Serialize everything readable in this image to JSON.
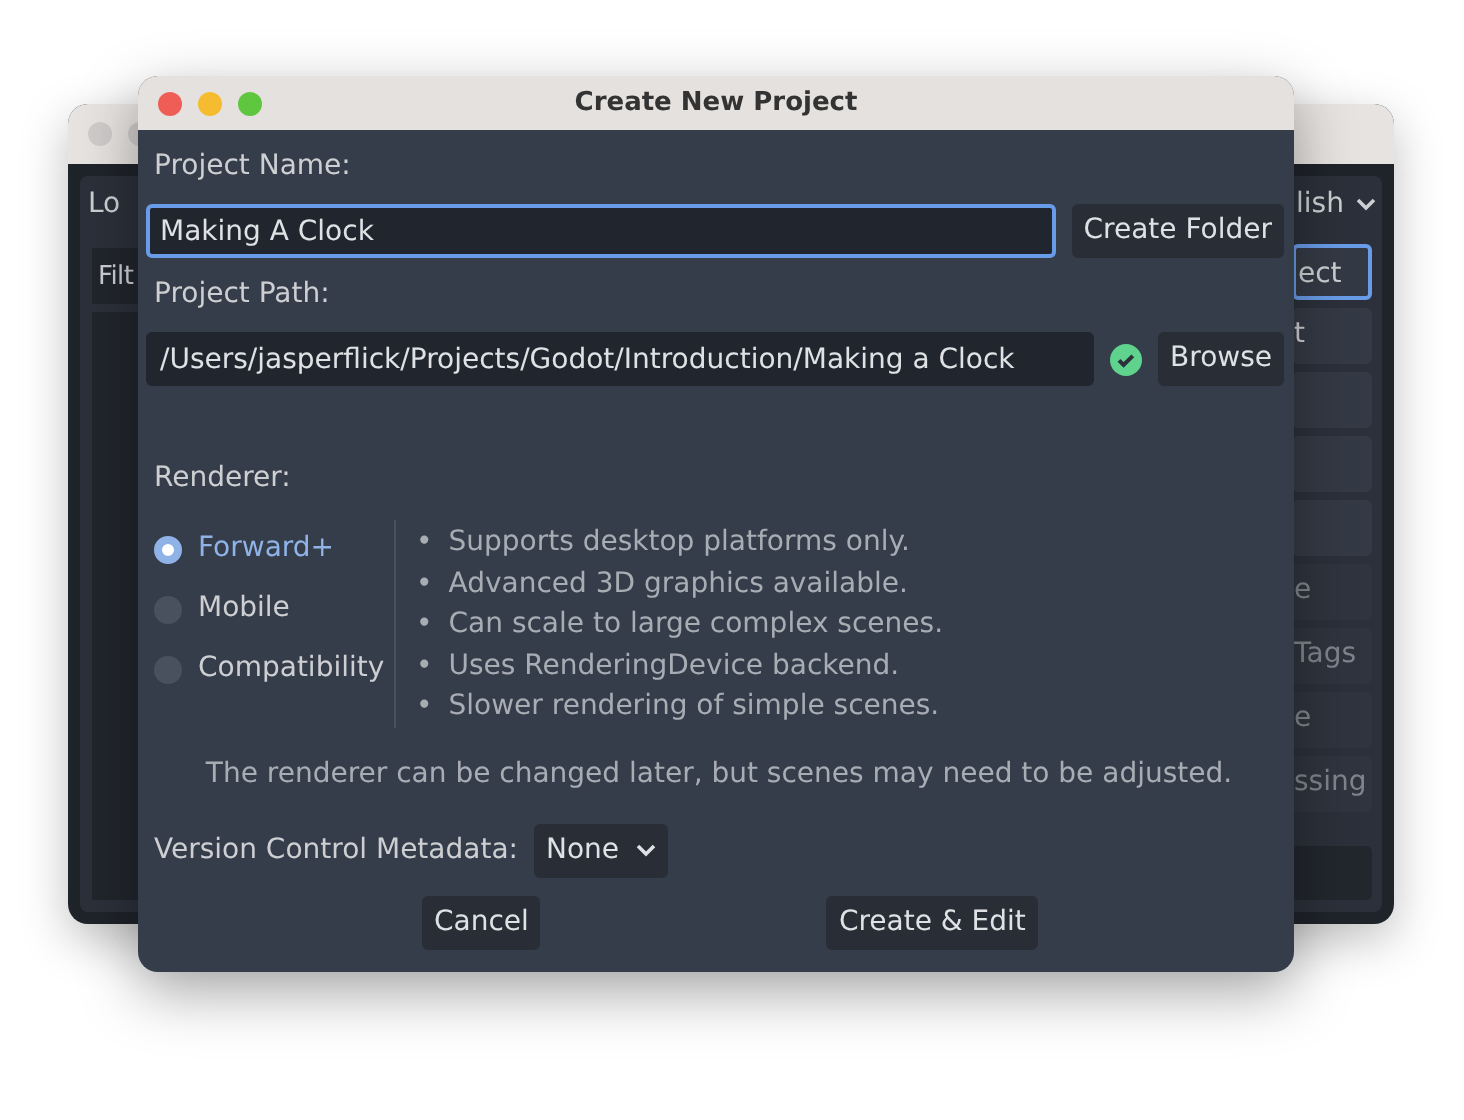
{
  "background_window": {
    "tab": "Lo",
    "filter": "Filt",
    "language": "lish",
    "side_items": [
      {
        "kind": "button",
        "label": "ect",
        "focused": true
      },
      {
        "kind": "button",
        "label": "t",
        "focused": false
      },
      {
        "kind": "blank"
      },
      {
        "kind": "blank"
      },
      {
        "kind": "blank"
      },
      {
        "kind": "dimmed",
        "label": "e"
      },
      {
        "kind": "dimmed",
        "label": "Tags"
      },
      {
        "kind": "dimmed",
        "label": "e"
      },
      {
        "kind": "dimmed",
        "label": "ssing"
      }
    ]
  },
  "dialog": {
    "title": "Create New Project",
    "name_label": "Project Name:",
    "name_value": "Making A Clock",
    "create_folder": "Create Folder",
    "path_label": "Project Path:",
    "path_value": "/Users/jasperflick/Projects/Godot/Introduction/Making a Clock",
    "path_valid": true,
    "browse": "Browse",
    "renderer_label": "Renderer:",
    "renderers": [
      {
        "label": "Forward+",
        "selected": true
      },
      {
        "label": "Mobile",
        "selected": false
      },
      {
        "label": "Compatibility",
        "selected": false
      }
    ],
    "features": [
      "Supports desktop platforms only.",
      "Advanced 3D graphics available.",
      "Can scale to large complex scenes.",
      "Uses RenderingDevice backend.",
      "Slower rendering of simple scenes."
    ],
    "bullet": "•",
    "note": "The renderer can be changed later, but scenes may need to be adjusted.",
    "vcs_label": "Version Control Metadata:",
    "vcs_value": "None",
    "buttons": [
      "Cancel",
      "Create & Edit"
    ]
  }
}
